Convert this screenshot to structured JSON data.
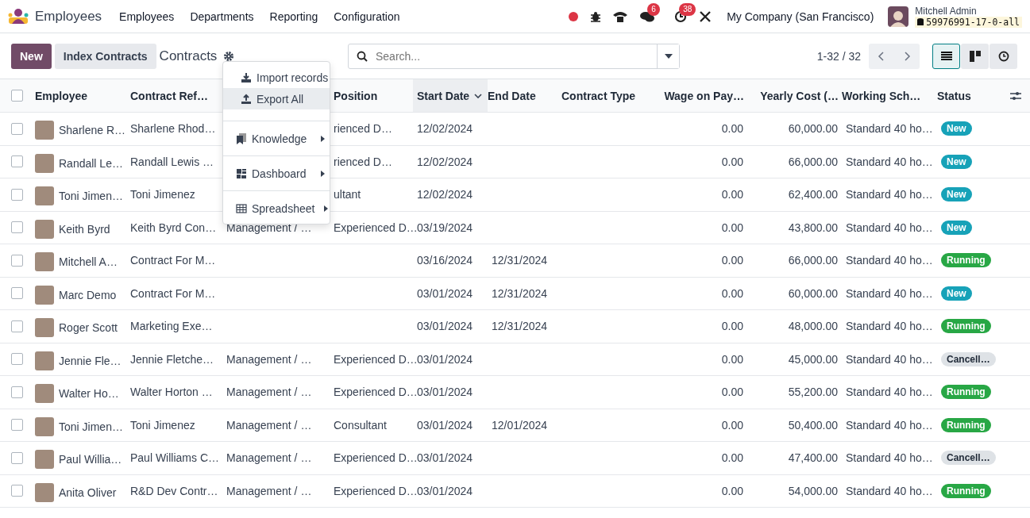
{
  "navbar": {
    "app_name": "Employees",
    "menu": [
      "Employees",
      "Departments",
      "Reporting",
      "Configuration"
    ],
    "systray": {
      "messages_count": "6",
      "activities_count": "38",
      "company": "My Company (San Francisco)",
      "user_name": "Mitchell Admin",
      "database": "59976991-17-0-all"
    }
  },
  "control_panel": {
    "buttons": [
      {
        "label": "New",
        "kind": "primary"
      },
      {
        "label": "Index Contracts",
        "kind": "secondary"
      }
    ],
    "breadcrumb": "Contracts",
    "search": {
      "placeholder": "Search..."
    },
    "pager": "1-32 / 32",
    "views": [
      {
        "kind": "list",
        "selected": true
      },
      {
        "kind": "kanban",
        "selected": false
      },
      {
        "kind": "activity",
        "selected": false
      }
    ]
  },
  "gear_menu": {
    "items": [
      {
        "label": "Import records",
        "submenu": false,
        "selected": false
      },
      {
        "label": "Export All",
        "submenu": false,
        "selected": true
      },
      {
        "label": "Knowledge",
        "submenu": true,
        "selected": false
      },
      {
        "label": "Dashboard",
        "submenu": true,
        "selected": false
      },
      {
        "label": "Spreadsheet",
        "submenu": true,
        "selected": false
      }
    ]
  },
  "table": {
    "select_all": false,
    "columns": [
      {
        "label": "Employee",
        "sorted": false
      },
      {
        "label": "Contract Ref…",
        "sorted": false
      },
      null,
      {
        "label": "Position",
        "sorted": false
      },
      {
        "label": "Start Date",
        "sorted": true
      },
      {
        "label": "End Date",
        "sorted": false
      },
      {
        "label": "Contract Type",
        "sorted": false
      },
      {
        "label": "Wage on Pay…",
        "sorted": false
      },
      {
        "label": "Yearly Cost (…",
        "sorted": false
      },
      {
        "label": "Working Sch…",
        "sorted": false
      },
      {
        "label": "Status",
        "sorted": false
      }
    ],
    "rows": [
      {
        "checked": false,
        "cells": [
          "Sharlene R…",
          "Sharlene Rhod…",
          null,
          "rienced D…",
          "12/02/2024",
          null,
          null,
          "0.00",
          "60,000.00",
          "Standard 40 ho…"
        ],
        "status": "New",
        "kind": "new"
      },
      {
        "checked": false,
        "cells": [
          "Randall Le…",
          "Randall Lewis …",
          null,
          "rienced D…",
          "12/02/2024",
          null,
          null,
          "0.00",
          "66,000.00",
          "Standard 40 ho…"
        ],
        "status": "New",
        "kind": "new"
      },
      {
        "checked": false,
        "cells": [
          "Toni Jimen…",
          "Toni Jimenez",
          null,
          "ultant",
          "12/02/2024",
          null,
          null,
          "0.00",
          "62,400.00",
          "Standard 40 ho…"
        ],
        "status": "New",
        "kind": "new"
      },
      {
        "checked": false,
        "cells": [
          "Keith Byrd",
          "Keith Byrd Con…",
          "Management / …",
          "Experienced D…",
          "03/19/2024",
          null,
          null,
          "0.00",
          "43,800.00",
          "Standard 40 ho…"
        ],
        "status": "New",
        "kind": "new"
      },
      {
        "checked": false,
        "cells": [
          "Mitchell A…",
          "Contract For M…",
          null,
          null,
          "03/16/2024",
          "12/31/2024",
          null,
          "0.00",
          "66,000.00",
          "Standard 40 ho…"
        ],
        "status": "Running",
        "kind": "running"
      },
      {
        "checked": false,
        "cells": [
          "Marc Demo",
          "Contract For M…",
          null,
          null,
          "03/01/2024",
          "12/31/2024",
          null,
          "0.00",
          "60,000.00",
          "Standard 40 ho…"
        ],
        "status": "New",
        "kind": "new"
      },
      {
        "checked": false,
        "cells": [
          "Roger Scott",
          "Marketing Exe…",
          null,
          null,
          "03/01/2024",
          "12/31/2024",
          null,
          "0.00",
          "48,000.00",
          "Standard 40 ho…"
        ],
        "status": "Running",
        "kind": "running"
      },
      {
        "checked": false,
        "cells": [
          "Jennie Fle…",
          "Jennie Fletche…",
          "Management / …",
          "Experienced D…",
          "03/01/2024",
          null,
          null,
          "0.00",
          "45,000.00",
          "Standard 40 ho…"
        ],
        "status": "Cancell…",
        "kind": "cancelled"
      },
      {
        "checked": false,
        "cells": [
          "Walter Ho…",
          "Walter Horton …",
          "Management / …",
          "Experienced D…",
          "03/01/2024",
          null,
          null,
          "0.00",
          "55,200.00",
          "Standard 40 ho…"
        ],
        "status": "Running",
        "kind": "running"
      },
      {
        "checked": false,
        "cells": [
          "Toni Jimen…",
          "Toni Jimenez",
          "Management / …",
          "Consultant",
          "03/01/2024",
          "12/01/2024",
          null,
          "0.00",
          "50,400.00",
          "Standard 40 ho…"
        ],
        "status": "Running",
        "kind": "running"
      },
      {
        "checked": false,
        "cells": [
          "Paul Willia…",
          "Paul Williams C…",
          "Management / …",
          "Experienced D…",
          "03/01/2024",
          null,
          null,
          "0.00",
          "47,400.00",
          "Standard 40 ho…"
        ],
        "status": "Cancell…",
        "kind": "cancelled"
      },
      {
        "checked": false,
        "cells": [
          "Anita Oliver",
          "R&D Dev Contr…",
          "Management / …",
          "Experienced D…",
          "03/01/2024",
          null,
          null,
          "0.00",
          "54,000.00",
          "Standard 40 ho…"
        ],
        "status": "Running",
        "kind": "running"
      }
    ]
  }
}
